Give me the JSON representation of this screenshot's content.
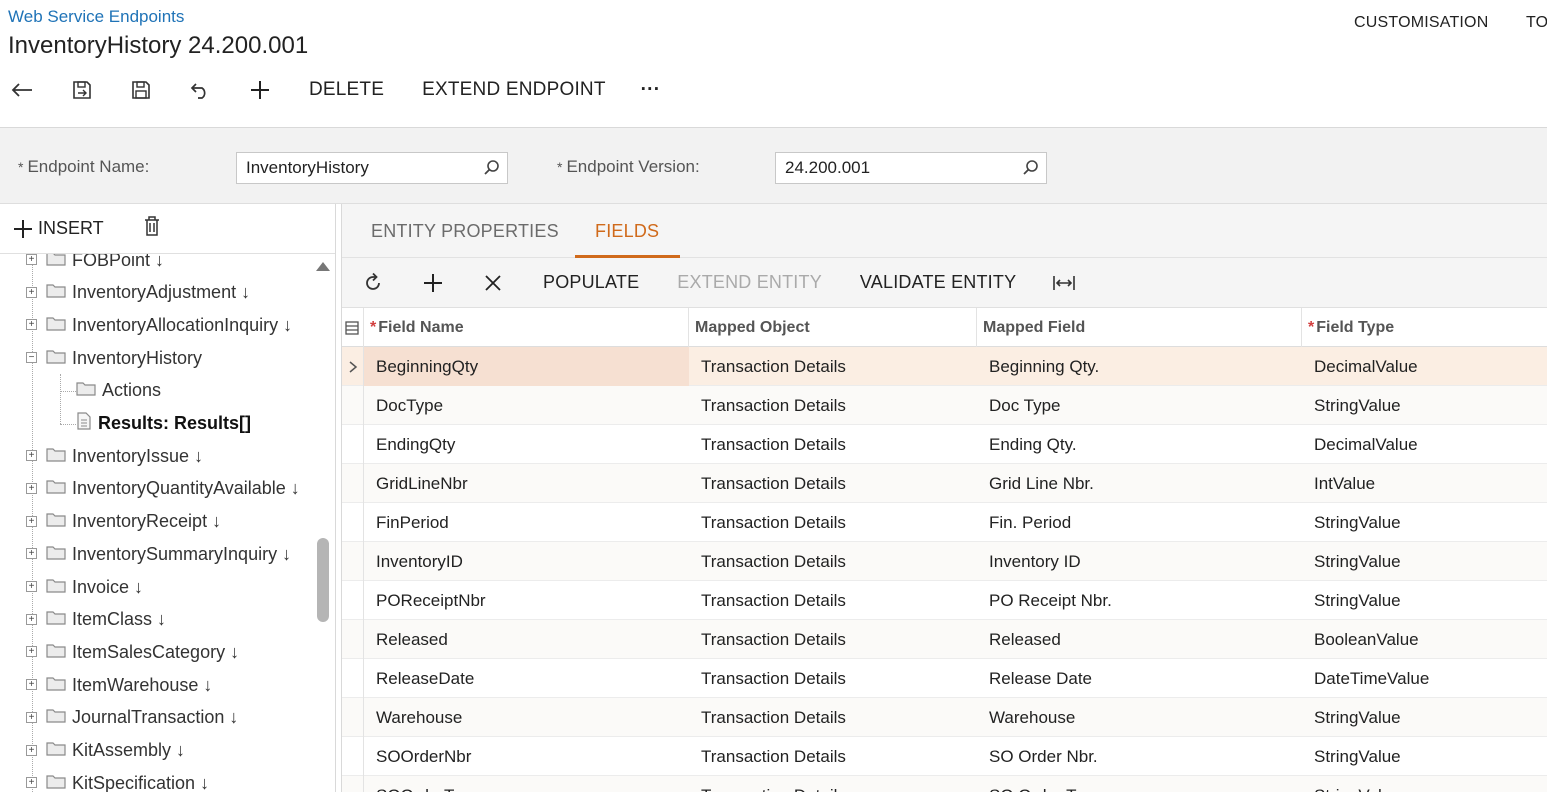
{
  "header": {
    "breadcrumb": "Web Service Endpoints",
    "title": "InventoryHistory 24.200.001",
    "customisation": "CUSTOMISATION",
    "tools": "TO",
    "toolbar": {
      "delete_label": "DELETE",
      "extend_endpoint_label": "EXTEND ENDPOINT",
      "more_label": "···"
    }
  },
  "form": {
    "endpoint_name_label": "Endpoint Name:",
    "endpoint_name_value": "InventoryHistory",
    "endpoint_version_label": "Endpoint Version:",
    "endpoint_version_value": "24.200.001",
    "required_mark": "*"
  },
  "left_panel": {
    "insert_label": "INSERT",
    "tree": [
      {
        "label": "FOBPoint ↓"
      },
      {
        "label": "InventoryAdjustment ↓"
      },
      {
        "label": "InventoryAllocationInquiry ↓"
      },
      {
        "label": "InventoryHistory"
      },
      {
        "label": "Actions"
      },
      {
        "label": "Results: Results[]"
      },
      {
        "label": "InventoryIssue ↓"
      },
      {
        "label": "InventoryQuantityAvailable ↓"
      },
      {
        "label": "InventoryReceipt ↓"
      },
      {
        "label": "InventorySummaryInquiry ↓"
      },
      {
        "label": "Invoice ↓"
      },
      {
        "label": "ItemClass ↓"
      },
      {
        "label": "ItemSalesCategory ↓"
      },
      {
        "label": "ItemWarehouse ↓"
      },
      {
        "label": "JournalTransaction ↓"
      },
      {
        "label": "KitAssembly ↓"
      },
      {
        "label": "KitSpecification ↓"
      }
    ]
  },
  "tabs": {
    "entity_properties": "ENTITY PROPERTIES",
    "fields": "FIELDS"
  },
  "grid_toolbar": {
    "populate": "POPULATE",
    "extend_entity": "EXTEND ENTITY",
    "validate_entity": "VALIDATE ENTITY"
  },
  "grid": {
    "columns": {
      "field_name": "Field Name",
      "mapped_object": "Mapped Object",
      "mapped_field": "Mapped Field",
      "field_type": "Field Type"
    },
    "rows": [
      {
        "field_name": "BeginningQty",
        "mapped_object": "Transaction Details",
        "mapped_field": "Beginning Qty.",
        "field_type": "DecimalValue"
      },
      {
        "field_name": "DocType",
        "mapped_object": "Transaction Details",
        "mapped_field": "Doc Type",
        "field_type": "StringValue"
      },
      {
        "field_name": "EndingQty",
        "mapped_object": "Transaction Details",
        "mapped_field": "Ending Qty.",
        "field_type": "DecimalValue"
      },
      {
        "field_name": "GridLineNbr",
        "mapped_object": "Transaction Details",
        "mapped_field": "Grid Line Nbr.",
        "field_type": "IntValue"
      },
      {
        "field_name": "FinPeriod",
        "mapped_object": "Transaction Details",
        "mapped_field": "Fin. Period",
        "field_type": "StringValue"
      },
      {
        "field_name": "InventoryID",
        "mapped_object": "Transaction Details",
        "mapped_field": "Inventory ID",
        "field_type": "StringValue"
      },
      {
        "field_name": "POReceiptNbr",
        "mapped_object": "Transaction Details",
        "mapped_field": "PO Receipt Nbr.",
        "field_type": "StringValue"
      },
      {
        "field_name": "Released",
        "mapped_object": "Transaction Details",
        "mapped_field": "Released",
        "field_type": "BooleanValue"
      },
      {
        "field_name": "ReleaseDate",
        "mapped_object": "Transaction Details",
        "mapped_field": "Release Date",
        "field_type": "DateTimeValue"
      },
      {
        "field_name": "Warehouse",
        "mapped_object": "Transaction Details",
        "mapped_field": "Warehouse",
        "field_type": "StringValue"
      },
      {
        "field_name": "SOOrderNbr",
        "mapped_object": "Transaction Details",
        "mapped_field": "SO Order Nbr.",
        "field_type": "StringValue"
      },
      {
        "field_name": "SOOrderType",
        "mapped_object": "Transaction Details",
        "mapped_field": "SO Order Type",
        "field_type": "StringValue"
      }
    ]
  },
  "colors": {
    "accent": "#d06a1b",
    "link": "#1f73b7",
    "selected_row": "#fbeee3"
  }
}
